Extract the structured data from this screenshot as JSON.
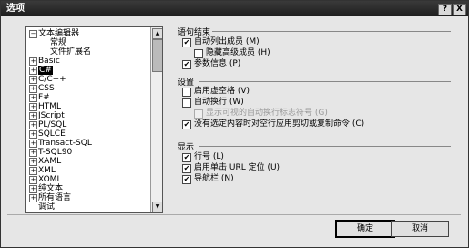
{
  "window": {
    "title": "选项",
    "help_label": "?",
    "close_label": "X"
  },
  "tree": {
    "items": [
      {
        "expander": "−",
        "label": "文本编辑器",
        "level": 0,
        "selected": false
      },
      {
        "expander": "",
        "label": "常规",
        "level": 1,
        "selected": false
      },
      {
        "expander": "",
        "label": "文件扩展名",
        "level": 1,
        "selected": false
      },
      {
        "expander": "+",
        "label": "Basic",
        "level": 0,
        "selected": false
      },
      {
        "expander": "+",
        "label": "C#",
        "level": 0,
        "selected": true
      },
      {
        "expander": "+",
        "label": "C/C++",
        "level": 0,
        "selected": false
      },
      {
        "expander": "+",
        "label": "CSS",
        "level": 0,
        "selected": false
      },
      {
        "expander": "+",
        "label": "F#",
        "level": 0,
        "selected": false
      },
      {
        "expander": "+",
        "label": "HTML",
        "level": 0,
        "selected": false
      },
      {
        "expander": "+",
        "label": "JScript",
        "level": 0,
        "selected": false
      },
      {
        "expander": "+",
        "label": "PL/SQL",
        "level": 0,
        "selected": false
      },
      {
        "expander": "+",
        "label": "SQLCE",
        "level": 0,
        "selected": false
      },
      {
        "expander": "+",
        "label": "Transact-SQL",
        "level": 0,
        "selected": false
      },
      {
        "expander": "+",
        "label": "T-SQL90",
        "level": 0,
        "selected": false
      },
      {
        "expander": "+",
        "label": "XAML",
        "level": 0,
        "selected": false
      },
      {
        "expander": "+",
        "label": "XML",
        "level": 0,
        "selected": false
      },
      {
        "expander": "+",
        "label": "XOML",
        "level": 0,
        "selected": false
      },
      {
        "expander": "+",
        "label": "纯文本",
        "level": 0,
        "selected": false
      },
      {
        "expander": "+",
        "label": "所有语言",
        "level": 0,
        "selected": false
      },
      {
        "expander": "",
        "label": "调试",
        "level": 0,
        "selected": false
      }
    ]
  },
  "groups": {
    "statement_completion": {
      "title": "语句结束",
      "options": [
        {
          "label": "自动列出成员 (M)",
          "checked": true,
          "enabled": true,
          "indent": 0
        },
        {
          "label": "隐藏高级成员 (H)",
          "checked": false,
          "enabled": true,
          "indent": 1
        },
        {
          "label": "参数信息 (P)",
          "checked": true,
          "enabled": true,
          "indent": 0
        }
      ]
    },
    "settings": {
      "title": "设置",
      "options": [
        {
          "label": "启用虚空格 (V)",
          "checked": false,
          "enabled": true,
          "indent": 0
        },
        {
          "label": "自动换行 (W)",
          "checked": false,
          "enabled": true,
          "indent": 0
        },
        {
          "label": "显示可视的自动换行标志符号 (G)",
          "checked": false,
          "enabled": false,
          "indent": 1
        },
        {
          "label": "没有选定内容时对空行应用剪切或复制命令 (C)",
          "checked": true,
          "enabled": true,
          "indent": 0
        }
      ]
    },
    "display": {
      "title": "显示",
      "options": [
        {
          "label": "行号 (L)",
          "checked": true,
          "enabled": true,
          "indent": 0
        },
        {
          "label": "启用单击 URL 定位 (U)",
          "checked": true,
          "enabled": true,
          "indent": 0
        },
        {
          "label": "导航栏 (N)",
          "checked": true,
          "enabled": true,
          "indent": 0
        }
      ]
    }
  },
  "buttons": {
    "ok": "确定",
    "cancel": "取消"
  },
  "icons": {
    "check": "✔",
    "scroll_up": "▲",
    "scroll_down": "▼"
  }
}
